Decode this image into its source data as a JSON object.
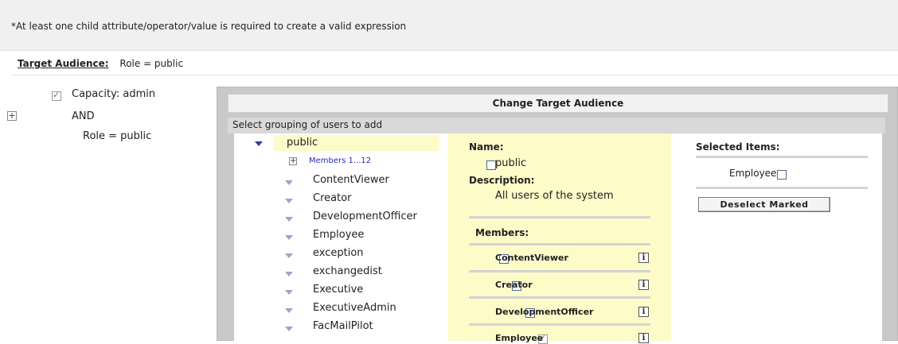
{
  "note": "*At least one child attribute/operator/value is required to create a valid expression",
  "target_audience": {
    "label": "Target Audience:",
    "value": "Role = public"
  },
  "left_tree": {
    "capacity": "Capacity:  admin",
    "operator": "AND",
    "role": "Role = public",
    "expand_symbol": "+"
  },
  "panel": {
    "title": "Change Target Audience",
    "group_label": "Select grouping of users to add"
  },
  "tree": {
    "root": "public",
    "members_link": "Members 1...12",
    "expand_symbol": "+",
    "items": [
      "ContentViewer",
      "Creator",
      "DevelopmentOfficer",
      "Employee",
      "exception",
      "exchangedist",
      "Executive",
      "ExecutiveAdmin",
      "FacMailPilot"
    ]
  },
  "details": {
    "name_label": "Name:",
    "name_value": "public",
    "description_label": "Description:",
    "description_value": "All users of the system",
    "members_label": "Members:",
    "info_glyph": "i",
    "members": [
      {
        "name": "ContentViewer",
        "checked": false
      },
      {
        "name": "Creator",
        "checked": false
      },
      {
        "name": "DevelopmentOfficer",
        "checked": false
      },
      {
        "name": "Employee",
        "checked": true
      }
    ]
  },
  "selected": {
    "title": "Selected Items:",
    "items": [
      "Employee"
    ],
    "deselect_button": "Deselect Marked"
  }
}
